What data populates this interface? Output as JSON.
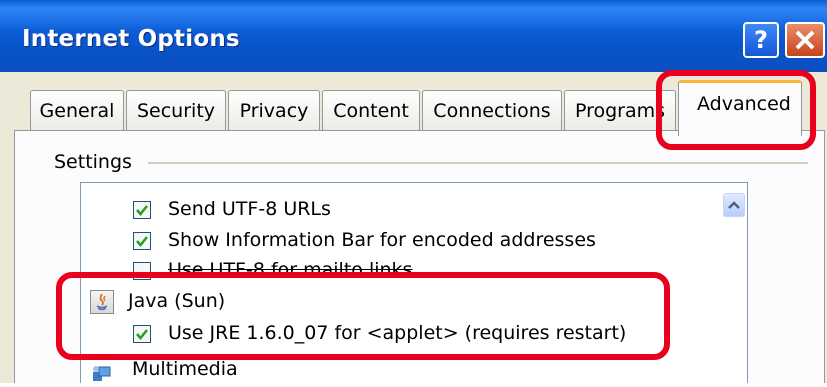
{
  "window": {
    "title": "Internet Options",
    "help_label": "?"
  },
  "tabs": [
    {
      "label": "General"
    },
    {
      "label": "Security"
    },
    {
      "label": "Privacy"
    },
    {
      "label": "Content"
    },
    {
      "label": "Connections"
    },
    {
      "label": "Programs"
    },
    {
      "label": "Advanced",
      "active": true
    }
  ],
  "settings": {
    "group_label": "Settings",
    "items": [
      {
        "label": "Send UTF-8 URLs",
        "checked": true
      },
      {
        "label": "Show Information Bar for encoded addresses",
        "checked": true
      },
      {
        "label": "Use UTF-8 for mailto links",
        "checked": false
      },
      {
        "label": "Java (Sun)",
        "type": "category",
        "icon": "java-icon"
      },
      {
        "label": "Use JRE 1.6.0_07 for <applet> (requires restart)",
        "checked": true
      },
      {
        "label": "Multimedia",
        "type": "category",
        "icon": "multimedia-icon"
      }
    ]
  },
  "colors": {
    "highlight": "#e8001c",
    "titlebar": "#0a5fd7",
    "active_tab_accent": "#f6b83e"
  }
}
